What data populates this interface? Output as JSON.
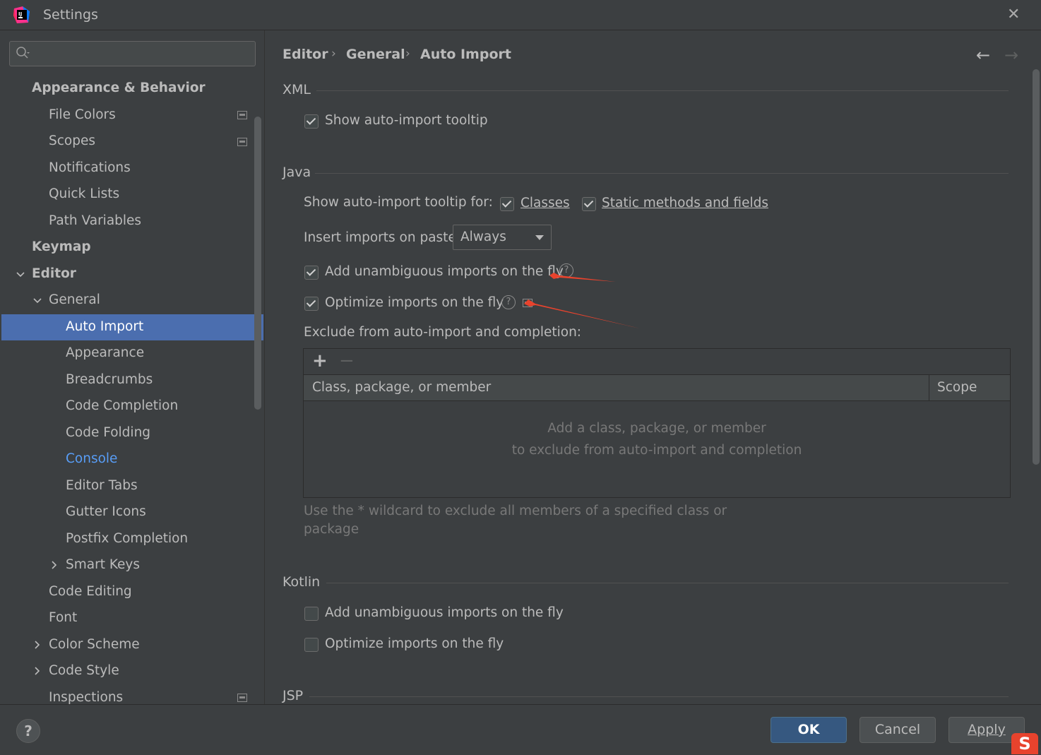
{
  "window": {
    "title": "Settings"
  },
  "sidebar": {
    "search_placeholder": "",
    "items": [
      {
        "label": "Appearance & Behavior",
        "level": 0
      },
      {
        "label": "File Colors",
        "level": 1
      },
      {
        "label": "Scopes",
        "level": 1
      },
      {
        "label": "Notifications",
        "level": 1
      },
      {
        "label": "Quick Lists",
        "level": 1
      },
      {
        "label": "Path Variables",
        "level": 1
      },
      {
        "label": "Keymap",
        "level": 0
      },
      {
        "label": "Editor",
        "level": 0
      },
      {
        "label": "General",
        "level": 1
      },
      {
        "label": "Auto Import",
        "level": 2
      },
      {
        "label": "Appearance",
        "level": 2
      },
      {
        "label": "Breadcrumbs",
        "level": 2
      },
      {
        "label": "Code Completion",
        "level": 2
      },
      {
        "label": "Code Folding",
        "level": 2
      },
      {
        "label": "Console",
        "level": 2
      },
      {
        "label": "Editor Tabs",
        "level": 2
      },
      {
        "label": "Gutter Icons",
        "level": 2
      },
      {
        "label": "Postfix Completion",
        "level": 2
      },
      {
        "label": "Smart Keys",
        "level": 2
      },
      {
        "label": "Code Editing",
        "level": 1
      },
      {
        "label": "Font",
        "level": 1
      },
      {
        "label": "Color Scheme",
        "level": 1
      },
      {
        "label": "Code Style",
        "level": 1
      },
      {
        "label": "Inspections",
        "level": 1
      }
    ]
  },
  "breadcrumb": [
    "Editor",
    "General",
    "Auto Import"
  ],
  "xml": {
    "title": "XML",
    "show_tooltip_label": "Show auto-import tooltip",
    "show_tooltip_checked": true
  },
  "java": {
    "title": "Java",
    "tooltip_for_label": "Show auto-import tooltip for:",
    "classes_label": "Classes",
    "classes_checked": true,
    "static_label": "Static methods and fields",
    "static_checked": true,
    "insert_label": "Insert imports on paste:",
    "insert_value": "Always",
    "add_unambiguous_label": "Add unambiguous imports on the fly",
    "add_unambiguous_checked": true,
    "optimize_label": "Optimize imports on the fly",
    "optimize_checked": true,
    "exclude_label": "Exclude from auto-import and completion:",
    "table": {
      "add": "+",
      "remove": "−",
      "col1": "Class, package, or member",
      "col2": "Scope",
      "empty_line1": "Add a class, package, or member",
      "empty_line2": "to exclude from auto-import and completion"
    },
    "hint_line1": "Use the * wildcard to exclude all members of a specified class or",
    "hint_line2": "package"
  },
  "kotlin": {
    "title": "Kotlin",
    "add_unambiguous_label": "Add unambiguous imports on the fly",
    "add_unambiguous_checked": false,
    "optimize_label": "Optimize imports on the fly",
    "optimize_checked": false
  },
  "jsp": {
    "title": "JSP"
  },
  "footer": {
    "ok": "OK",
    "cancel": "Cancel",
    "apply": "Apply",
    "help": "?"
  },
  "colors": {
    "accent": "#4b6eaf",
    "annotation": "#e8432d"
  }
}
